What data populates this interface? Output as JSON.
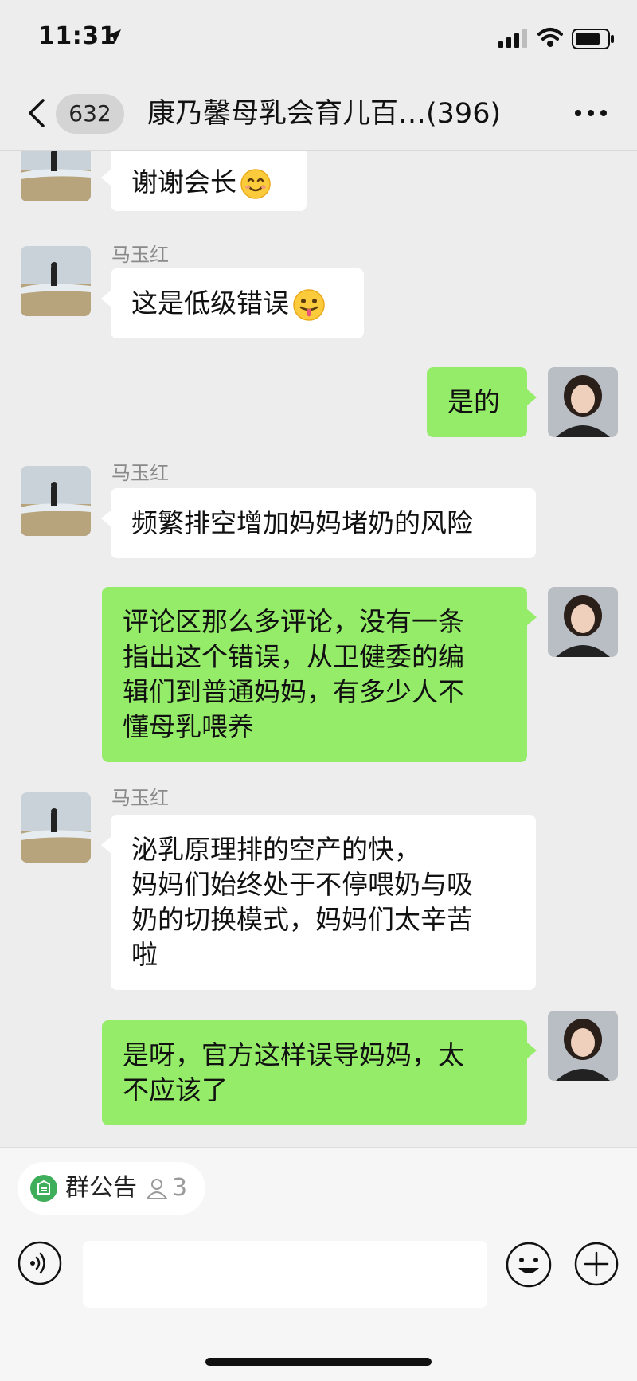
{
  "status_bar": {
    "time": "11:31"
  },
  "header": {
    "unread_count": "632",
    "title": "康乃馨母乳会育儿百…(396)"
  },
  "messages": [
    {
      "side": "in",
      "sender": "",
      "text": "谢谢会长",
      "emoji": "smiling-face"
    },
    {
      "side": "in",
      "sender": "马玉红",
      "text": "这是低级错误",
      "emoji": "face-with-tongue"
    },
    {
      "side": "out",
      "text": "是的"
    },
    {
      "side": "in",
      "sender": "马玉红",
      "text": "频繁排空增加妈妈堵奶的风险"
    },
    {
      "side": "out",
      "lines": [
        "评论区那么多评论，没有一条",
        "指出这个错误，从卫健委的编",
        "辑们到普通妈妈，有多少人不",
        "懂母乳喂养"
      ]
    },
    {
      "side": "in",
      "sender": "马玉红",
      "lines": [
        "泌乳原理排的空产的快，",
        "妈妈们始终处于不停喂奶与吸",
        "奶的切换模式，妈妈们太辛苦",
        "啦"
      ]
    },
    {
      "side": "out",
      "lines": [
        "是呀，官方这样误导妈妈，太",
        "不应该了"
      ]
    }
  ],
  "bottom": {
    "announcement_label": "群公告",
    "announcement_count": "3",
    "input_value": ""
  },
  "colors": {
    "background": "#ededed",
    "incoming_bubble": "#ffffff",
    "outgoing_bubble": "#95ec69",
    "announce_icon": "#3fae5b"
  },
  "icons": [
    "location-arrow-icon",
    "signal-icon",
    "wifi-icon",
    "battery-icon",
    "back-chevron-icon",
    "more-icon",
    "announcement-icon",
    "person-icon",
    "voice-icon",
    "emoji-icon",
    "plus-icon"
  ]
}
